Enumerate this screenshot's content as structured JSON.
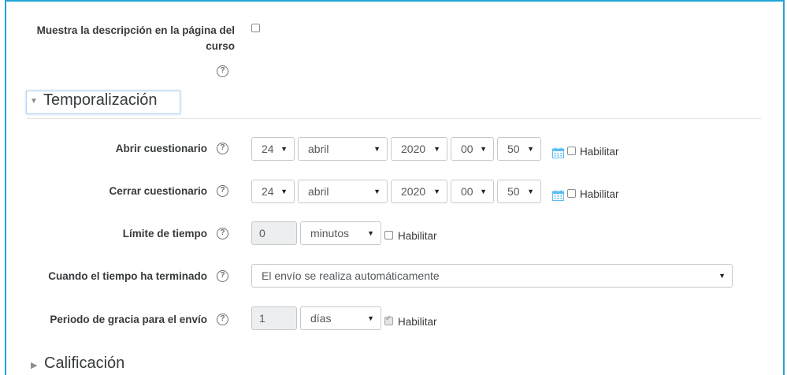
{
  "desc": {
    "label_line1": "Muestra la descripción en la página del",
    "label_line2": "curso"
  },
  "timing": {
    "heading": "Temporalización",
    "open": {
      "label": "Abrir cuestionario",
      "day": "24",
      "month": "abril",
      "year": "2020",
      "hour": "00",
      "minute": "50",
      "enable_label": "Habilitar"
    },
    "close": {
      "label": "Cerrar cuestionario",
      "day": "24",
      "month": "abril",
      "year": "2020",
      "hour": "00",
      "minute": "50",
      "enable_label": "Habilitar"
    },
    "limit": {
      "label": "Límite de tiempo",
      "value": "0",
      "unit": "minutos",
      "enable_label": "Habilitar"
    },
    "overdue": {
      "label": "Cuando el tiempo ha terminado",
      "value": "El envío se realiza automáticamente"
    },
    "grace": {
      "label": "Periodo de gracia para el envío",
      "value": "1",
      "unit": "días",
      "enable_label": "Habilitar"
    }
  },
  "grade": {
    "heading": "Calificación"
  },
  "icons": {
    "help": "question-circle-icon",
    "calendar": "calendar-icon",
    "expand": "caret-icon"
  },
  "colors": {
    "frame": "#1fa6d8",
    "calendar": "#5bbcf2",
    "focus": "#b7d4ee"
  }
}
